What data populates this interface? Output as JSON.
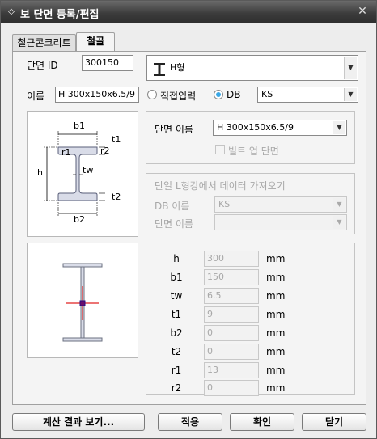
{
  "window": {
    "title": "보 단면 등록/편집",
    "title_icon": "diamond-icon",
    "close": "✕"
  },
  "tabs": [
    {
      "label": "철근콘크리트",
      "active": false
    },
    {
      "label": "철골",
      "active": true
    }
  ],
  "section_id": {
    "label": "단면 ID",
    "value": "300150"
  },
  "shape": {
    "value": "H형",
    "icon": "h-beam-icon"
  },
  "name": {
    "label": "이름",
    "value": "H 300x150x6.5/9"
  },
  "input_mode": {
    "direct_label": "직접입력",
    "db_label": "DB",
    "selected": "DB"
  },
  "db": {
    "value": "KS"
  },
  "section_name": {
    "label": "단면 이름",
    "value": "H 300x150x6.5/9"
  },
  "built_up": {
    "label": "빌트 업 단면",
    "checked": false
  },
  "single_l": {
    "title": "단일 L형강에서 데이터 가져오기",
    "db_label": "DB 이름",
    "db_value": "KS",
    "section_label": "단면 이름",
    "section_value": ""
  },
  "diagram_labels": {
    "b1": "b1",
    "t1": "t1",
    "r1": "r1",
    "r2": "r2",
    "h": "h",
    "tw": "tw",
    "t2": "t2",
    "b2": "b2"
  },
  "dimensions": [
    {
      "key": "h",
      "value": "300",
      "unit": "mm"
    },
    {
      "key": "b1",
      "value": "150",
      "unit": "mm"
    },
    {
      "key": "tw",
      "value": "6.5",
      "unit": "mm"
    },
    {
      "key": "t1",
      "value": "9",
      "unit": "mm"
    },
    {
      "key": "b2",
      "value": "0",
      "unit": "mm"
    },
    {
      "key": "t2",
      "value": "0",
      "unit": "mm"
    },
    {
      "key": "r1",
      "value": "13",
      "unit": "mm"
    },
    {
      "key": "r2",
      "value": "0",
      "unit": "mm"
    }
  ],
  "buttons": {
    "view_results": "계산 결과 보기...",
    "apply": "적용",
    "ok": "확인",
    "close": "닫기"
  },
  "colors": {
    "accent": "#39a7e6",
    "beam_fill": "#d9dce8",
    "axis": "#e02020",
    "web": "#6b0e6b"
  }
}
